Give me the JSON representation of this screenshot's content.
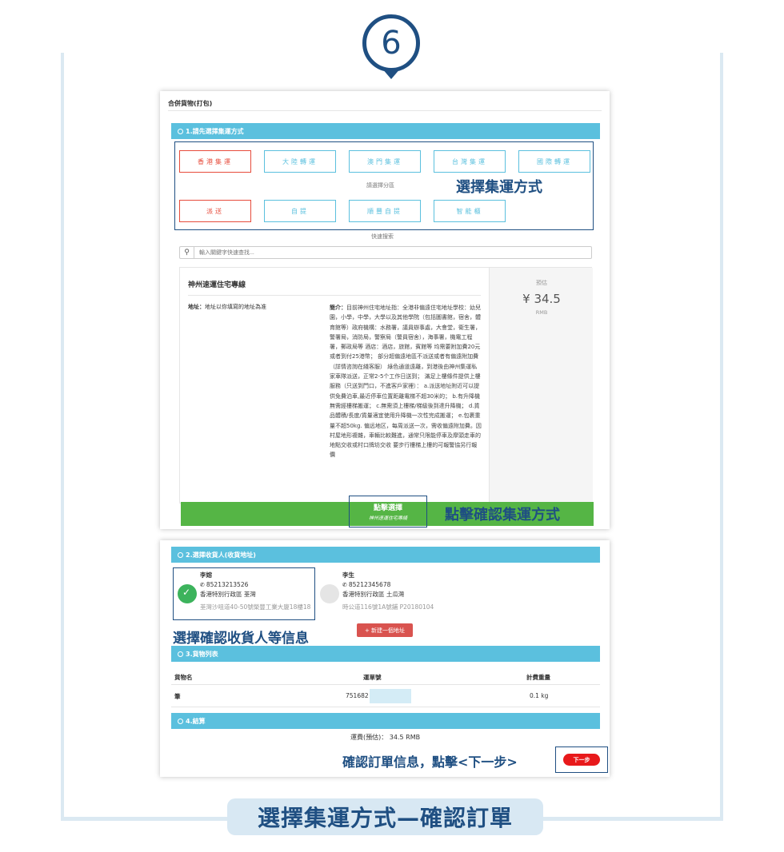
{
  "step_number": "6",
  "banner_text": "選擇集運方式—確認訂單",
  "panel1": {
    "header": "合併貨物(打包)",
    "section1_title": "1.請先選擇集運方式",
    "options_row1": [
      "香港集運",
      "大陸轉運",
      "澳門集運",
      "台灣集運",
      "國際轉運"
    ],
    "region_label": "請選擇分區",
    "options_row2": [
      "派送",
      "自提",
      "順豐自提",
      "智能櫃"
    ],
    "callout_choose": "選擇集運方式",
    "quick_search_label": "快速搜索",
    "search_placeholder": "輸入關鍵字快速查找...",
    "route": {
      "name": "神州速運住宅專線",
      "address_label": "地址：",
      "address_value": "地址以你填寫的地址為准",
      "intro_label": "簡介：",
      "intro_text": "目前神州住宅地址指：全港非偏遠住宅地址學校：幼兒園，小學，中學，大學以及其他學院（包括圖書館，宿舍，體育館等）政府機構：水務署，議員辦事處，大會堂，衛生署，警署局，消防局，警察局（警員宿舍），海事署，機電工程署，郵政局等 酒店：酒店，旅館，賓館等 均需要附加費20元或者到付25港幣； 部分超偏遠地區不派送或者有偏遠附加費（詳情咨詢在綫客服） 綠色通道遠離，到港後由神州集運私家車隊派送，正常2-5个工作日送到； 滿足上樓條件提供上樓服務（只送到門口，不進客戶家裡）： a.派送地址附近可以提供免費泊車,最近停車位置距離電梯不超30米的； b.有升降機無需經樓梯搬運； c.無需須上樓梯/梯級後到達升降機； d.貨品體積/長度/貨量適宜使用升降機一次性完成搬運； e.包裹重量不超50kg. 偏远地区，每周派送一次，需收偏遠附加費。因村屋地形複雜，車輛比較難進，通常只限能停車及摩頭走車的地點交收或村口牌坊交收 要步行樓梯上樓的可報警協另行報價",
      "price_label": "預估",
      "price_value": "¥ 34.5",
      "price_unit": "RMB",
      "select_button": "點擊選擇",
      "select_sub": "神州速運住宅專綫"
    },
    "callout_confirm_route": "點擊確認集運方式"
  },
  "panel2": {
    "section2_title": "2.選擇收貨人(收貨地址)",
    "contacts": [
      {
        "name": "李嫆",
        "phone": "85213213526",
        "region": "香港特別行政區 荃灣",
        "address": "荃灣沙咀道40-50號榮豐工業大廈18樓18"
      },
      {
        "name": "李生",
        "phone": "85212345678",
        "region": "香港特別行政區 土瓜灣",
        "address": "時公道116號1A號鋪 P20180104"
      }
    ],
    "callout_consignee": "選擇確認收貨人等信息",
    "new_address_button": "+ 新建一個地址",
    "section3_title": "3.貨物列表",
    "table_headers": [
      "貨物名",
      "運單號",
      "計費重量"
    ],
    "table_rows": [
      {
        "name": "筆",
        "tracking": "751682",
        "weight": "0.1 kg"
      }
    ],
    "section4_title": "4.結算",
    "freight_text": "運費(預估)： 34.5 RMB",
    "callout_next": "確認訂單信息，點擊<下一步>",
    "next_button": "下一步"
  },
  "colors": {
    "accent_blue": "#1f4f82",
    "section_bar": "#5bc0de",
    "select_green": "#55b545",
    "active_red": "#e74c3c"
  }
}
